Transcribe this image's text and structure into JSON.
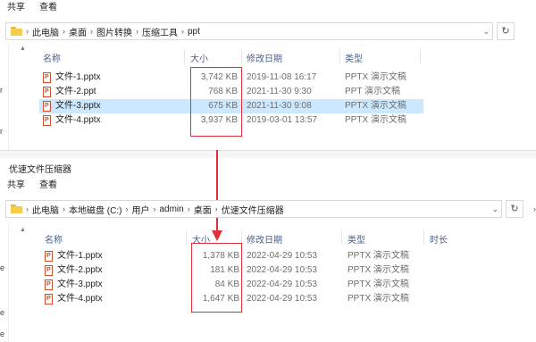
{
  "top_window": {
    "ribbon_tabs": [
      "共享",
      "查看"
    ],
    "breadcrumb": [
      "此电脑",
      "桌面",
      "图片转换",
      "压缩工具",
      "ppt"
    ],
    "columns": {
      "name": "名称",
      "size": "大小",
      "date": "修改日期",
      "type": "类型"
    },
    "files": [
      {
        "name": "文件-1.pptx",
        "size": "3,742 KB",
        "date": "2019-11-08 16:17",
        "type": "PPTX 演示文稿",
        "selected": false
      },
      {
        "name": "文件-2.ppt",
        "size": "768 KB",
        "date": "2021-11-30 9:30",
        "type": "PPT 演示文稿",
        "selected": false
      },
      {
        "name": "文件-3.pptx",
        "size": "675 KB",
        "date": "2021-11-30 9:08",
        "type": "PPTX 演示文稿",
        "selected": true
      },
      {
        "name": "文件-4.pptx",
        "size": "3,937 KB",
        "date": "2019-03-01 13:57",
        "type": "PPTX 演示文稿",
        "selected": false
      }
    ],
    "nav_marks": [
      "r",
      "r"
    ]
  },
  "bottom_window": {
    "title": "优速文件压缩器",
    "ribbon_tabs": [
      "共享",
      "查看"
    ],
    "breadcrumb": [
      "此电脑",
      "本地磁盘 (C:)",
      "用户",
      "admin",
      "桌面",
      "优速文件压缩器"
    ],
    "columns": {
      "name": "名称",
      "size": "大小",
      "date": "修改日期",
      "type": "类型",
      "duration": "时长"
    },
    "files": [
      {
        "name": "文件-1.pptx",
        "size": "1,378 KB",
        "date": "2022-04-29 10:53",
        "type": "PPTX 演示文稿"
      },
      {
        "name": "文件-2.pptx",
        "size": "181 KB",
        "date": "2022-04-29 10:53",
        "type": "PPTX 演示文稿"
      },
      {
        "name": "文件-3.pptx",
        "size": "84 KB",
        "date": "2022-04-29 10:53",
        "type": "PPTX 演示文稿"
      },
      {
        "name": "文件-4.pptx",
        "size": "1,647 KB",
        "date": "2022-04-29 10:53",
        "type": "PPTX 演示文稿"
      }
    ],
    "nav_marks": [
      "e",
      "e",
      "e"
    ]
  },
  "colors": {
    "highlight": "#e0303a",
    "selection": "#cce8ff",
    "header_text": "#4a5f8a"
  },
  "icons": {
    "folder": "folder-icon",
    "pptx": "pptx-file-icon",
    "refresh": "refresh-icon",
    "dropdown": "chevron-down-icon",
    "arrow": "down-arrow-annotation"
  }
}
